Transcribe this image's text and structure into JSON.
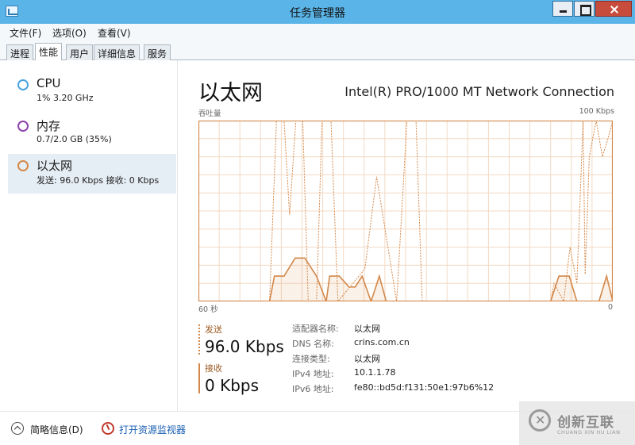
{
  "window": {
    "title": "任务管理器"
  },
  "menu": [
    "文件(F)",
    "选项(O)",
    "查看(V)"
  ],
  "tabs": [
    "进程",
    "性能",
    "用户",
    "详细信息",
    "服务"
  ],
  "sidebar": {
    "items": [
      {
        "name": "CPU",
        "sub": "1% 3.20 GHz",
        "color": "#4aa3df"
      },
      {
        "name": "内存",
        "sub": "0.7/2.0 GB (35%)",
        "color": "#8e44ad"
      },
      {
        "name": "以太网",
        "sub": "发送: 96.0 Kbps 接收: 0 Kbps",
        "color": "#d3884a"
      }
    ]
  },
  "main": {
    "title": "以太网",
    "adapter": "Intel(R) PRO/1000 MT Network Connection",
    "chart_label_top_left": "吞吐量",
    "chart_label_top_right": "100 Kbps",
    "chart_label_bottom_left": "60 秒",
    "chart_label_bottom_right": "0",
    "send_label": "发送",
    "send_value": "96.0 Kbps",
    "recv_label": "接收",
    "recv_value": "0 Kbps",
    "props": [
      {
        "key": "适配器名称:",
        "value": "以太网"
      },
      {
        "key": "DNS 名称:",
        "value": "crins.com.cn"
      },
      {
        "key": "连接类型:",
        "value": "以太网"
      },
      {
        "key": "IPv4 地址:",
        "value": "10.1.1.78"
      },
      {
        "key": "IPv6 地址:",
        "value": "fe80::bd5d:f131:50e1:97b6%12"
      }
    ]
  },
  "footer": {
    "fewer_details": "简略信息(D)",
    "resource_monitor": "打开资源监视器"
  },
  "watermark": {
    "text": "创新互联",
    "sub": "CHUANG XIN HU LIAN"
  },
  "colors": {
    "accent": "#d3884a",
    "titlebar": "#5ab4e8",
    "grid": "#f3d9c3"
  },
  "chart_data": {
    "type": "line",
    "title": "吞吐量",
    "xlabel": "60 秒",
    "ylabel": "",
    "xlim": [
      60,
      0
    ],
    "ylim": [
      0,
      100
    ],
    "grid": true,
    "series": [
      {
        "name": "发送",
        "style": "dashed",
        "points": [
          [
            60,
            0
          ],
          [
            49.7,
            0
          ],
          [
            48.7,
            100
          ],
          [
            47.6,
            100
          ],
          [
            46.8,
            48
          ],
          [
            45.9,
            100
          ],
          [
            44.9,
            100
          ],
          [
            44.1,
            0
          ],
          [
            42.9,
            0
          ],
          [
            42.1,
            100
          ],
          [
            40.8,
            100
          ],
          [
            39.8,
            0
          ],
          [
            35.9,
            18
          ],
          [
            34.2,
            69
          ],
          [
            31.3,
            0
          ],
          [
            29.8,
            100
          ],
          [
            28.5,
            100
          ],
          [
            27.6,
            0
          ],
          [
            9.0,
            0
          ],
          [
            8.5,
            10
          ],
          [
            7.1,
            0
          ],
          [
            6.2,
            30
          ],
          [
            5.2,
            10
          ],
          [
            4.3,
            100
          ],
          [
            4.0,
            15
          ],
          [
            3.4,
            80
          ],
          [
            2.4,
            100
          ],
          [
            1.5,
            80
          ],
          [
            0.7,
            90
          ],
          [
            0,
            100
          ]
        ]
      },
      {
        "name": "接收",
        "style": "solid",
        "points": [
          [
            60,
            0
          ],
          [
            49.7,
            0
          ],
          [
            49.0,
            14
          ],
          [
            47.6,
            14
          ],
          [
            46.0,
            24
          ],
          [
            44.6,
            24
          ],
          [
            42.9,
            14
          ],
          [
            41.5,
            0
          ],
          [
            41.0,
            14
          ],
          [
            39.6,
            14
          ],
          [
            38.2,
            8
          ],
          [
            37.3,
            8
          ],
          [
            36.3,
            14
          ],
          [
            35.0,
            0
          ],
          [
            33.8,
            14
          ],
          [
            32.8,
            0
          ],
          [
            9.0,
            0
          ],
          [
            7.8,
            14
          ],
          [
            6.3,
            14
          ],
          [
            5.2,
            0
          ],
          [
            2.0,
            0
          ],
          [
            0.9,
            14
          ],
          [
            0,
            0
          ]
        ]
      }
    ]
  }
}
